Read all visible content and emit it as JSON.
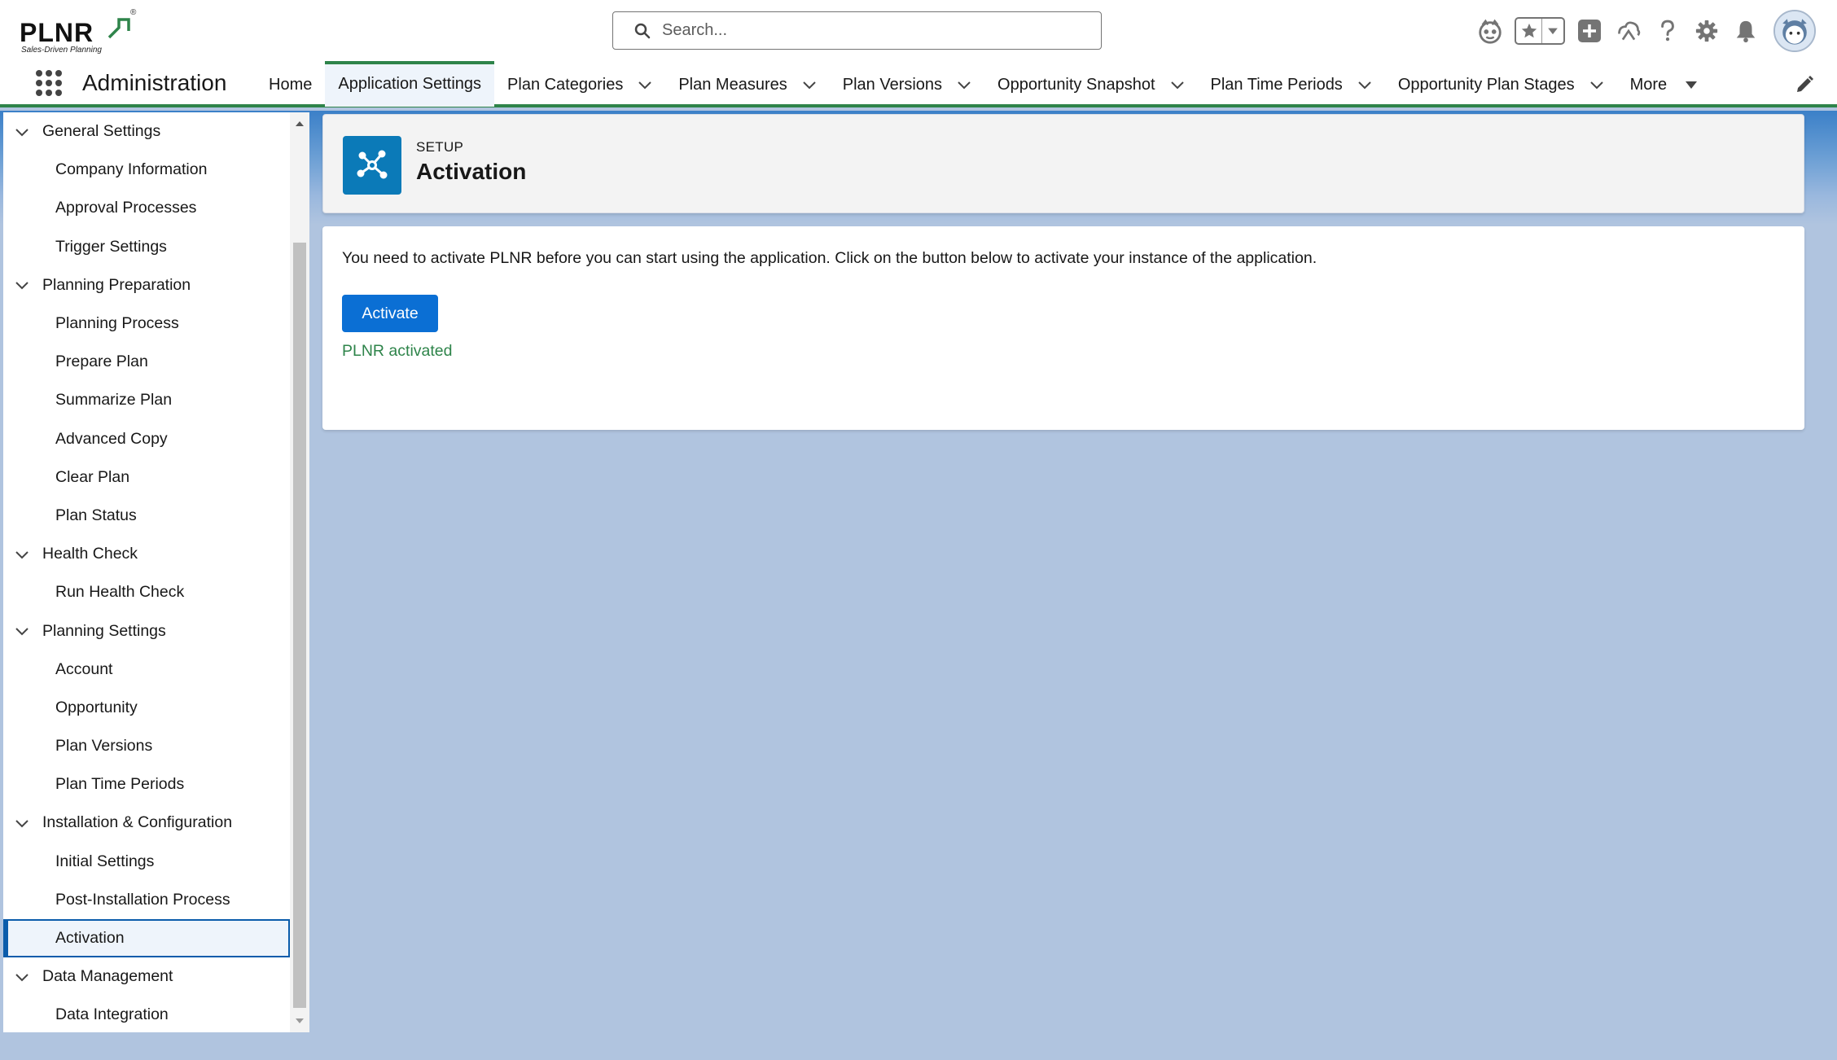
{
  "brand": {
    "logo_text": "PLNR",
    "tagline": "Sales-Driven Planning",
    "registered_mark": "®",
    "accent_color": "#2e844a",
    "primary_color": "#0b6fd4"
  },
  "header": {
    "search_placeholder": "Search...",
    "icons": [
      "einstein-icon",
      "favorites-star-icon",
      "favorites-menu-icon",
      "global-add-icon",
      "trailhead-icon",
      "help-icon",
      "setup-gear-icon",
      "notifications-bell-icon",
      "user-avatar"
    ]
  },
  "nav": {
    "app_name": "Administration",
    "items": [
      {
        "label": "Home",
        "has_menu": false
      },
      {
        "label": "Application Settings",
        "has_menu": false,
        "active": true
      },
      {
        "label": "Plan Categories",
        "has_menu": true
      },
      {
        "label": "Plan Measures",
        "has_menu": true
      },
      {
        "label": "Plan Versions",
        "has_menu": true
      },
      {
        "label": "Opportunity Snapshot",
        "has_menu": true
      },
      {
        "label": "Plan Time Periods",
        "has_menu": true
      },
      {
        "label": "Opportunity Plan Stages",
        "has_menu": true
      }
    ],
    "more_label": "More"
  },
  "sidebar": {
    "rows": [
      {
        "type": "group",
        "label": "General Settings"
      },
      {
        "type": "leaf",
        "label": "Company Information"
      },
      {
        "type": "leaf",
        "label": "Approval Processes"
      },
      {
        "type": "leaf",
        "label": "Trigger Settings"
      },
      {
        "type": "group",
        "label": "Planning Preparation"
      },
      {
        "type": "leaf",
        "label": "Planning Process"
      },
      {
        "type": "leaf",
        "label": "Prepare Plan"
      },
      {
        "type": "leaf",
        "label": "Summarize Plan"
      },
      {
        "type": "leaf",
        "label": "Advanced Copy"
      },
      {
        "type": "leaf",
        "label": "Clear Plan"
      },
      {
        "type": "leaf",
        "label": "Plan Status"
      },
      {
        "type": "group",
        "label": "Health Check"
      },
      {
        "type": "leaf",
        "label": "Run Health Check"
      },
      {
        "type": "group",
        "label": "Planning Settings"
      },
      {
        "type": "leaf",
        "label": "Account"
      },
      {
        "type": "leaf",
        "label": "Opportunity"
      },
      {
        "type": "leaf",
        "label": "Plan Versions"
      },
      {
        "type": "leaf",
        "label": "Plan Time Periods"
      },
      {
        "type": "group",
        "label": "Installation & Configuration"
      },
      {
        "type": "leaf",
        "label": "Initial Settings"
      },
      {
        "type": "leaf",
        "label": "Post-Installation Process"
      },
      {
        "type": "leaf",
        "label": "Activation",
        "selected": true
      },
      {
        "type": "group",
        "label": "Data Management"
      },
      {
        "type": "leaf",
        "label": "Data Integration"
      }
    ]
  },
  "page": {
    "eyebrow": "SETUP",
    "title": "Activation",
    "message": "You need to activate PLNR before you can start using the application. Click on the button below to activate your instance of the application.",
    "activate_label": "Activate",
    "status": "PLNR activated"
  }
}
